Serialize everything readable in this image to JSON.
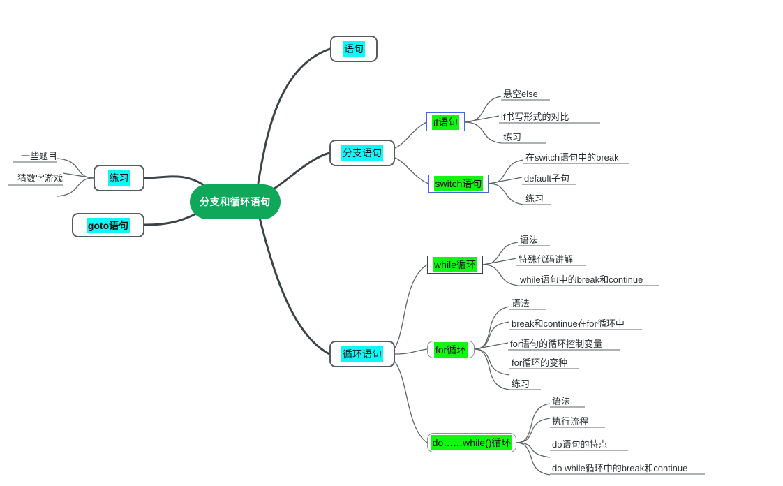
{
  "diagram": {
    "type": "mind-map",
    "title": "分支和循环语句",
    "colors": {
      "root_fill": "#0fa85a",
      "root_text": "#ffffff",
      "highlight_cyan": "#0ff7f7",
      "highlight_green": "#12f712",
      "box_border": "#555b5e",
      "blue_border": "#4169e1",
      "connector": "#3d4447",
      "leaf_text": "#2b2f31",
      "background": "#ffffff"
    }
  },
  "root": {
    "label": "分支和循环语句"
  },
  "nodes": {
    "statement": {
      "label": "语句"
    },
    "branch": {
      "label": "分支语句"
    },
    "if": {
      "label": "if语句"
    },
    "switch": {
      "label": "switch语句"
    },
    "loop": {
      "label": "循环语句"
    },
    "while": {
      "label": "while循环"
    },
    "for": {
      "label": "for循环"
    },
    "dowhile": {
      "label": "do……while()循环"
    },
    "practice": {
      "label": "练习"
    },
    "goto": {
      "label": "goto语句"
    }
  },
  "leaves": {
    "practice_1": {
      "label": "一些题目"
    },
    "practice_2": {
      "label": "猜数字游戏"
    },
    "if_1": {
      "label": "悬空else"
    },
    "if_2": {
      "label": "if书写形式的对比"
    },
    "if_3": {
      "label": "练习"
    },
    "switch_1": {
      "label": "在switch语句中的break"
    },
    "switch_2": {
      "label": "default子句"
    },
    "switch_3": {
      "label": "练习"
    },
    "while_1": {
      "label": "语法"
    },
    "while_2": {
      "label": "特殊代码讲解"
    },
    "while_3": {
      "label": "while语句中的break和continue"
    },
    "for_1": {
      "label": "语法"
    },
    "for_2": {
      "label": "break和continue在for循环中"
    },
    "for_3": {
      "label": "for语句的循环控制变量"
    },
    "for_4": {
      "label": "for循环的变种"
    },
    "for_5": {
      "label": "练习"
    },
    "do_1": {
      "label": "语法"
    },
    "do_2": {
      "label": "执行流程"
    },
    "do_3": {
      "label": "do语句的特点"
    },
    "do_4": {
      "label": "do while循环中的break和continue"
    }
  }
}
